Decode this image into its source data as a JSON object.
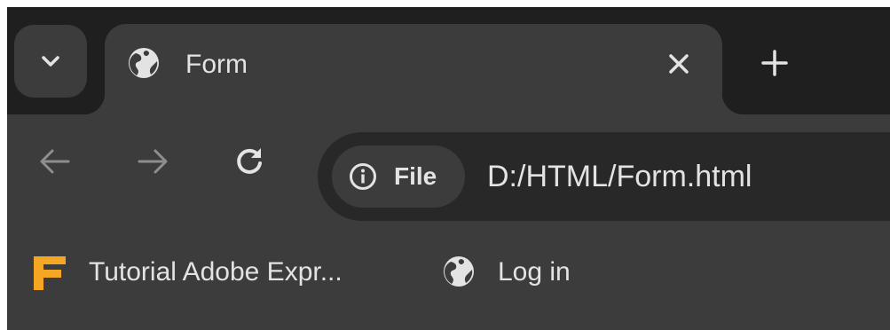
{
  "tabs": {
    "search_icon": "chevron-down-icon",
    "active_tab": {
      "title": "Form",
      "favicon": "globe-icon",
      "close_icon": "close-icon"
    },
    "new_tab_icon": "plus-icon"
  },
  "toolbar": {
    "back_icon": "arrow-left-icon",
    "forward_icon": "arrow-right-icon",
    "reload_icon": "reload-icon",
    "site_chip": {
      "icon": "info-icon",
      "label": "File"
    },
    "url": "D:/HTML/Form.html"
  },
  "bookmarks": [
    {
      "label": "Tutorial Adobe Expr...",
      "icon": "f-logo-icon"
    },
    {
      "label": "Log in",
      "icon": "globe-icon"
    }
  ],
  "colors": {
    "frame": "#1f1f1f",
    "toolbar": "#3c3c3c",
    "omnibox": "#282828",
    "text": "#e3e3e3",
    "disabled_icon": "#8e8e8e",
    "logo_accent": "#f5a623"
  }
}
